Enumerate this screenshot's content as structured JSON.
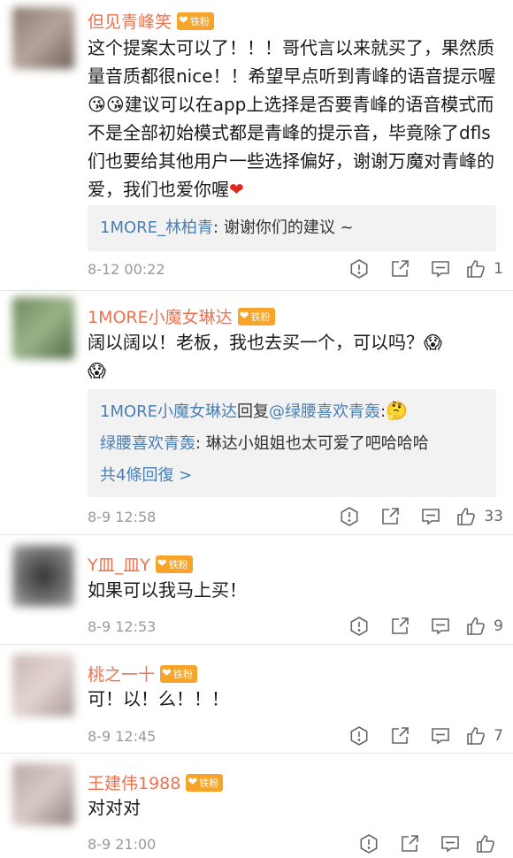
{
  "comments": [
    {
      "username": "但见青峰笑",
      "badge": "铁粉",
      "text_a": "这个提案太可以了！！！哥代言以来就买了，果然质量音质都很nice！！希望早点听到青峰的语音提示喔",
      "text_b": "建议可以在app上选择是否要青峰的语音模式而不是全部初始模式都是青峰的提示音，毕竟除了dfls们也要给其他用户一些选择偏好，谢谢万魔对青峰的爱，我们也爱你喔",
      "reply_name": "1MORE_林柏青",
      "reply_text": ": 谢谢你们的建议 ~",
      "time": "8-12 00:22",
      "likes": "1"
    },
    {
      "username": "1MORE小魔女琳达",
      "badge": "铁粉",
      "text_a": "阔以阔以！老板，我也去买一个，可以吗？",
      "reply1_name": "1MORE小魔女琳达",
      "reply1_mid": "回复",
      "reply1_to": "@绿腰喜欢青轰",
      "reply1_after": ":",
      "reply2_name": "绿腰喜欢青轰",
      "reply2_text": ": 琳达小姐姐也太可爱了吧哈哈哈",
      "more_replies": "共4條回復 >",
      "time": "8-9 12:58",
      "likes": "33"
    },
    {
      "username": "Y皿_皿Y",
      "badge": "铁粉",
      "text_a": "如果可以我马上买！",
      "time": "8-9 12:53",
      "likes": "9"
    },
    {
      "username": "桃之一十",
      "badge": "铁粉",
      "text_a": "可！以！么！！！",
      "time": "8-9 12:45",
      "likes": "7"
    },
    {
      "username": "王建伟1988",
      "badge": "铁粉",
      "text_a": "对对对",
      "time": "8-9 21:00",
      "likes": ""
    }
  ],
  "emoji": {
    "blush": "😘",
    "scream": "😱",
    "thinking": "🤔"
  },
  "icons": [
    "report-icon",
    "share-icon",
    "comment-icon",
    "like-icon"
  ]
}
